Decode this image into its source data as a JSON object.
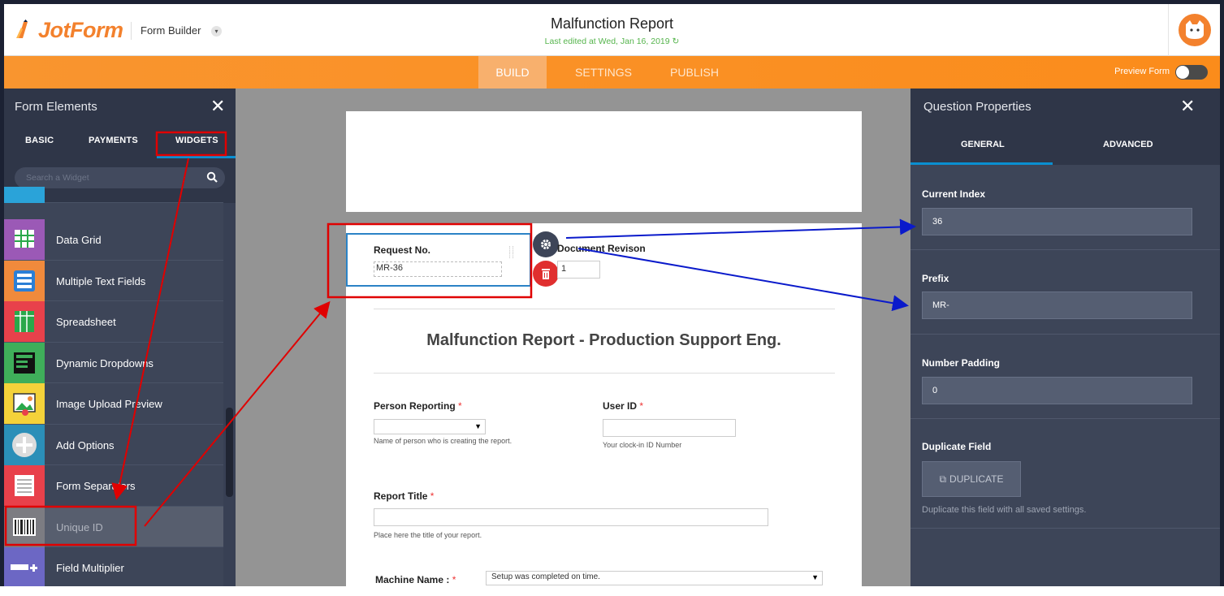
{
  "topbar": {
    "brand": "JotForm",
    "builder_label": "Form Builder",
    "form_title": "Malfunction Report",
    "last_edited": "Last edited at Wed, Jan 16, 2019"
  },
  "nav": {
    "tabs": [
      "BUILD",
      "SETTINGS",
      "PUBLISH"
    ],
    "active": "BUILD",
    "preview_label": "Preview Form",
    "preview_on": false
  },
  "left_panel": {
    "title": "Form Elements",
    "tabs": [
      "BASIC",
      "PAYMENTS",
      "WIDGETS"
    ],
    "active_tab": "WIDGETS",
    "search_placeholder": "Search a Widget",
    "widgets": [
      {
        "label": "Data Grid",
        "icon": "data-grid-icon",
        "color": "#9b59b6"
      },
      {
        "label": "Multiple Text Fields",
        "icon": "multiple-text-fields-icon",
        "color": "#f08a3c"
      },
      {
        "label": "Spreadsheet",
        "icon": "spreadsheet-icon",
        "color": "#e8414b"
      },
      {
        "label": "Dynamic Dropdowns",
        "icon": "dynamic-dropdowns-icon",
        "color": "#3fae5a"
      },
      {
        "label": "Image Upload Preview",
        "icon": "image-upload-preview-icon",
        "color": "#f4d23a"
      },
      {
        "label": "Add Options",
        "icon": "add-options-icon",
        "color": "#2b8fb8"
      },
      {
        "label": "Form Separators",
        "icon": "form-separators-icon",
        "color": "#e8414b"
      },
      {
        "label": "Unique ID",
        "icon": "barcode-icon",
        "color": "#7c7c82",
        "selected": true
      },
      {
        "label": "Field Multiplier",
        "icon": "field-multiplier-icon",
        "color": "#6c67c4"
      }
    ]
  },
  "form": {
    "request_no": {
      "label": "Request No.",
      "value": "MR-36"
    },
    "document_revision": {
      "label": "Document Revison",
      "value": "1"
    },
    "heading": "Malfunction Report - Production Support Eng.",
    "person_reporting": {
      "label": "Person Reporting",
      "required": "*",
      "sublabel": "Name of person who is creating the report."
    },
    "user_id": {
      "label": "User ID",
      "required": "*",
      "sublabel": "Your clock-in ID Number"
    },
    "report_title": {
      "label": "Report Title",
      "required": "*",
      "sublabel": "Place here the title of your report."
    },
    "machine_name": {
      "label": "Machine Name :",
      "required": "*",
      "value": "Setup was completed on time."
    }
  },
  "right_panel": {
    "title": "Question Properties",
    "tabs": [
      "GENERAL",
      "ADVANCED"
    ],
    "active_tab": "GENERAL",
    "current_index": {
      "label": "Current Index",
      "value": "36"
    },
    "prefix": {
      "label": "Prefix",
      "value": "MR-"
    },
    "number_padding": {
      "label": "Number Padding",
      "value": "0"
    },
    "duplicate": {
      "label": "Duplicate Field",
      "button": "DUPLICATE",
      "description": "Duplicate this field with all saved settings."
    }
  },
  "colors": {
    "brand_orange": "#f3812d",
    "accent_blue": "#0a8fd1",
    "annotation_red": "#e00000",
    "annotation_blue": "#0a1acb"
  }
}
